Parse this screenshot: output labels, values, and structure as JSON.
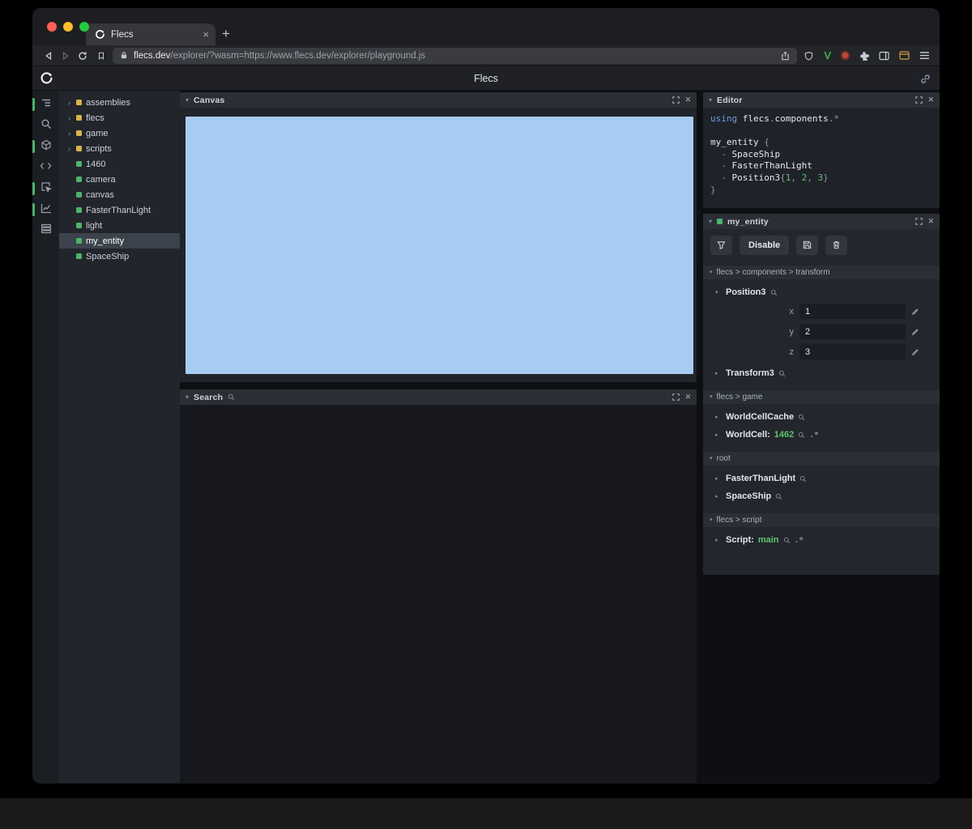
{
  "browser": {
    "tab_title": "Flecs",
    "url_domain": "flecs.dev",
    "url_path": "/explorer/?wasm=https://www.flecs.dev/explorer/playground.js"
  },
  "header": {
    "title": "Flecs"
  },
  "icons": {
    "close": "×",
    "plus": "+",
    "chevron_down": "▾",
    "chevron_right": "›",
    "collapsed": "▸"
  },
  "tree": {
    "items": [
      {
        "label": "assemblies",
        "type": "module",
        "expandable": true
      },
      {
        "label": "flecs",
        "type": "module",
        "expandable": true
      },
      {
        "label": "game",
        "type": "module",
        "expandable": true
      },
      {
        "label": "scripts",
        "type": "module",
        "expandable": true
      },
      {
        "label": "1460",
        "type": "entity"
      },
      {
        "label": "camera",
        "type": "entity"
      },
      {
        "label": "canvas",
        "type": "entity"
      },
      {
        "label": "FasterThanLight",
        "type": "entity"
      },
      {
        "label": "light",
        "type": "entity"
      },
      {
        "label": "my_entity",
        "type": "entity",
        "selected": true
      },
      {
        "label": "SpaceShip",
        "type": "entity"
      }
    ]
  },
  "panels": {
    "canvas": {
      "title": "Canvas"
    },
    "search": {
      "title": "Search"
    },
    "editor": {
      "title": "Editor"
    },
    "inspector": {
      "title": "my_entity"
    }
  },
  "editor_code": {
    "kw_using": "using",
    "id1": "flecs",
    "dot": ".",
    "id2": "components",
    "tail": ".*",
    "entity_name": "my_entity",
    "brace_open": "{",
    "dash": "-",
    "tag1": "SpaceShip",
    "tag2": "FasterThanLight",
    "comp": "Position3",
    "args_open": "{",
    "n1": "1",
    "comma": ",",
    "n2": "2",
    "n3": "3",
    "args_close": "}",
    "brace_close": "}"
  },
  "inspector": {
    "toolbar": {
      "disable_label": "Disable"
    },
    "sections": [
      {
        "path": "flecs > components > transform"
      },
      {
        "path": "flecs > game"
      },
      {
        "path": "root"
      },
      {
        "path": "flecs > script"
      }
    ],
    "position3": {
      "name": "Position3",
      "fields": [
        {
          "label": "x",
          "value": "1"
        },
        {
          "label": "y",
          "value": "2"
        },
        {
          "label": "z",
          "value": "3"
        }
      ]
    },
    "transform3": "Transform3",
    "worldcellcache": "WorldCellCache",
    "worldcell": {
      "name": "WorldCell:",
      "value": "1462",
      "suffix": ".*"
    },
    "root_items": [
      "FasterThanLight",
      "SpaceShip"
    ],
    "script": {
      "name": "Script:",
      "value": "main",
      "suffix": ".*"
    }
  },
  "colors": {
    "accent_green": "#4db36c",
    "module_yellow": "#d9b44a",
    "entity_green": "#4db36c",
    "canvas_blue": "#a8ccf1",
    "code_keyword": "#6f9fd8",
    "code_number": "#5bc46a",
    "value_green": "#5ec46f"
  }
}
